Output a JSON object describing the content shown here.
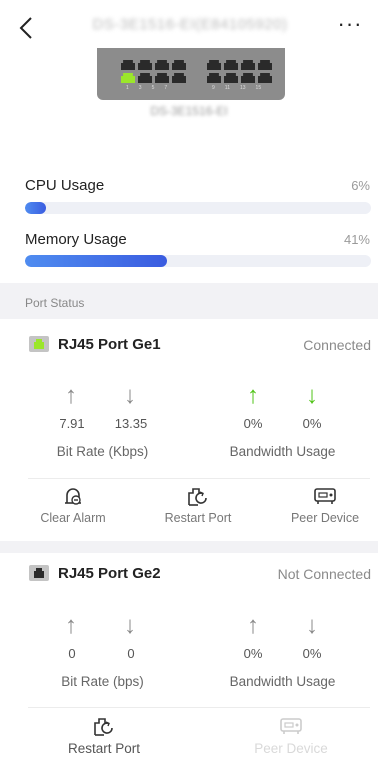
{
  "header": {
    "title": "DS-3E1516-EI(E84105920)",
    "more_label": "···"
  },
  "device": {
    "model": "DS-3E1516-EI",
    "port_numbers_left": [
      "1",
      "3",
      "5",
      "7"
    ],
    "port_numbers_right": [
      "9",
      "11",
      "13",
      "15"
    ]
  },
  "usage": {
    "cpu": {
      "label": "CPU Usage",
      "value": "6%",
      "fraction": 0.06
    },
    "memory": {
      "label": "Memory Usage",
      "value": "41%",
      "fraction": 0.41
    }
  },
  "port_status_label": "Port Status",
  "ports": [
    {
      "name": "RJ45 Port Ge1",
      "status": "Connected",
      "icon_color": "#9be62b",
      "tx": "7.91",
      "rx": "13.35",
      "bitrate_label": "Bit Rate (Kbps)",
      "bw_tx": "0%",
      "bw_rx": "0%",
      "bandwidth_label": "Bandwidth Usage",
      "actions": {
        "clear_alarm": "Clear Alarm",
        "restart": "Restart Port",
        "peer": "Peer Device"
      }
    },
    {
      "name": "RJ45 Port Ge2",
      "status": "Not Connected",
      "icon_color": "#2a2a2a",
      "tx": "0",
      "rx": "0",
      "bitrate_label": "Bit Rate (bps)",
      "bw_tx": "0%",
      "bw_rx": "0%",
      "bandwidth_label": "Bandwidth Usage",
      "actions": {
        "restart": "Restart Port",
        "peer": "Peer Device"
      }
    }
  ],
  "colors": {
    "accent": "#3a5ce0",
    "green": "#52c41a",
    "grey_arrow": "#8a8a8a"
  }
}
